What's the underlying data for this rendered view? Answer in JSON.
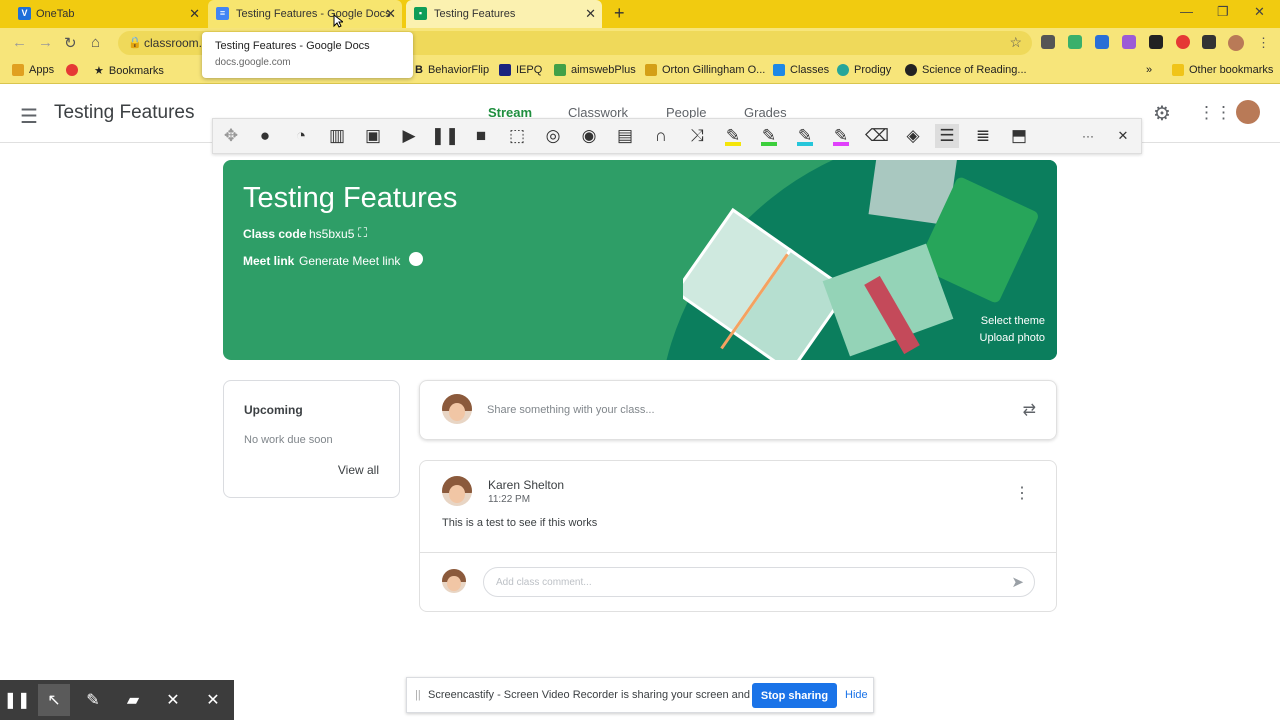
{
  "browser": {
    "tabs": [
      {
        "label": "OneTab",
        "icon": "onetab-icon"
      },
      {
        "label": "Testing Features - Google Docs",
        "icon": "docs-icon"
      },
      {
        "label": "Testing Features",
        "icon": "classroom-icon"
      }
    ],
    "address": "classroom.",
    "tooltip": {
      "title": "Testing Features - Google Docs",
      "url": "docs.google.com"
    },
    "bookmarks": [
      {
        "label": "Apps"
      },
      {
        "label": "Bookmarks"
      },
      {
        "label": "BehaviorFlip"
      },
      {
        "label": "IEPQ"
      },
      {
        "label": "aimswebPlus"
      },
      {
        "label": "Orton Gillingham O..."
      },
      {
        "label": "Classes"
      },
      {
        "label": "Prodigy"
      },
      {
        "label": "Science of Reading..."
      }
    ],
    "more_bookmarks": "»",
    "other_bookmarks": "Other bookmarks"
  },
  "header": {
    "class_title": "Testing Features",
    "tabs": [
      "Stream",
      "Classwork",
      "People",
      "Grades"
    ]
  },
  "banner": {
    "title": "Testing Features",
    "class_code_label": "Class code",
    "class_code": "hs5bxu5",
    "meet_label": "Meet link",
    "meet_value": "Generate Meet link",
    "select_theme": "Select theme",
    "upload_photo": "Upload photo",
    "colors": {
      "background": "#2e9e67",
      "accent": "#0b7e5d"
    }
  },
  "upcoming": {
    "title": "Upcoming",
    "empty": "No work due soon",
    "view_all": "View all"
  },
  "share": {
    "placeholder": "Share something with your class..."
  },
  "post": {
    "author": "Karen Shelton",
    "time": "11:22 PM",
    "body": "This is a test to see if this works",
    "comment_placeholder": "Add class comment..."
  },
  "notice": {
    "text": "Screencastify - Screen Video Recorder is sharing your screen and audio.",
    "stop": "Stop sharing",
    "hide": "Hide"
  }
}
